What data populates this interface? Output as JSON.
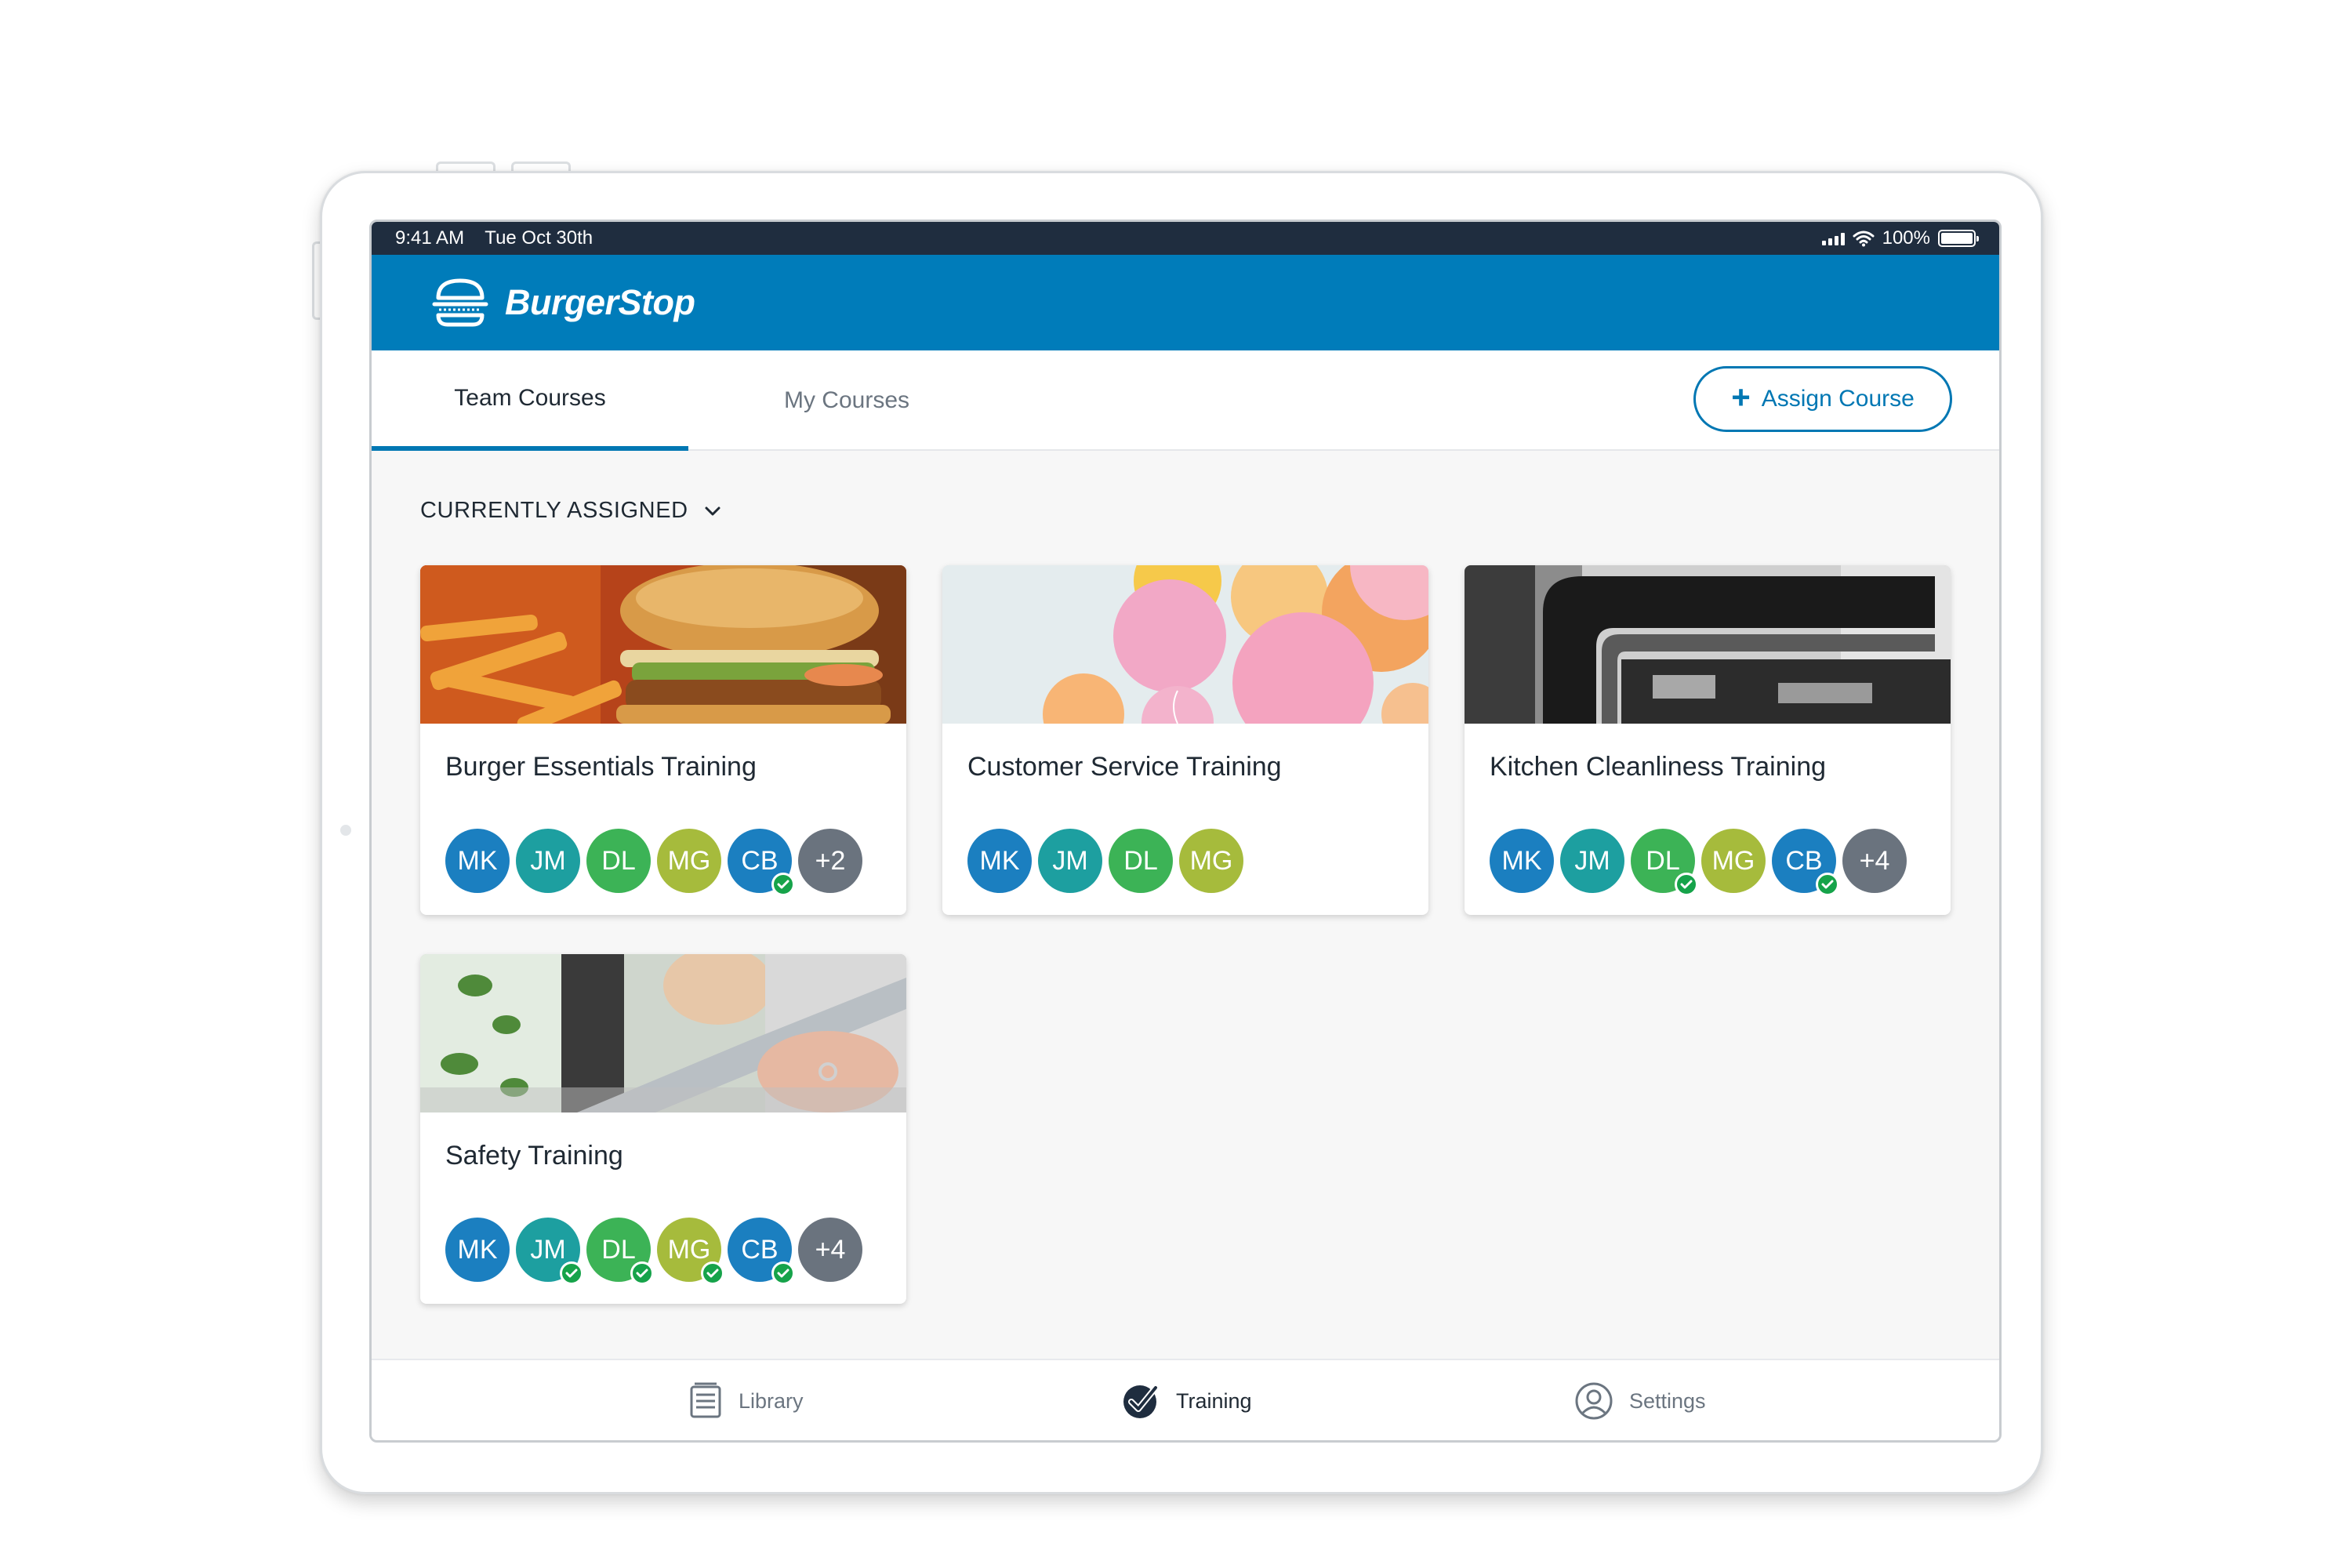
{
  "status_bar": {
    "time": "9:41 AM",
    "date": "Tue Oct 30th",
    "battery": "100%"
  },
  "header": {
    "brand": "BurgerStop",
    "color": "#007cba"
  },
  "tabs": [
    {
      "label": "Team Courses",
      "active": true
    },
    {
      "label": "My Courses",
      "active": false
    }
  ],
  "actions": {
    "assign_course_label": "Assign Course",
    "accent_color": "#0077b3"
  },
  "section": {
    "label": "CURRENTLY ASSIGNED"
  },
  "courses": [
    {
      "title": "Burger Essentials Training",
      "image": "burger-and-fries-photo",
      "avatars": [
        {
          "initials": "MK",
          "completed": false
        },
        {
          "initials": "JM",
          "completed": false
        },
        {
          "initials": "DL",
          "completed": false
        },
        {
          "initials": "MG",
          "completed": false
        },
        {
          "initials": "CB",
          "completed": true
        },
        {
          "initials": "+2",
          "completed": false
        }
      ]
    },
    {
      "title": "Customer Service Training",
      "image": "balloons-photo",
      "avatars": [
        {
          "initials": "MK",
          "completed": false
        },
        {
          "initials": "JM",
          "completed": false
        },
        {
          "initials": "DL",
          "completed": false
        },
        {
          "initials": "MG",
          "completed": false
        }
      ]
    },
    {
      "title": "Kitchen Cleanliness Training",
      "image": "kitchen-faucet-photo",
      "avatars": [
        {
          "initials": "MK",
          "completed": false
        },
        {
          "initials": "JM",
          "completed": false
        },
        {
          "initials": "DL",
          "completed": true
        },
        {
          "initials": "MG",
          "completed": false
        },
        {
          "initials": "CB",
          "completed": true
        },
        {
          "initials": "+4",
          "completed": false
        }
      ]
    },
    {
      "title": "Safety Training",
      "image": "knife-cutting-photo",
      "avatars": [
        {
          "initials": "MK",
          "completed": false
        },
        {
          "initials": "JM",
          "completed": true
        },
        {
          "initials": "DL",
          "completed": true
        },
        {
          "initials": "MG",
          "completed": true
        },
        {
          "initials": "CB",
          "completed": true
        },
        {
          "initials": "+4",
          "completed": false
        }
      ]
    }
  ],
  "bottom_nav": [
    {
      "label": "Library",
      "icon": "library-icon",
      "active": false
    },
    {
      "label": "Training",
      "icon": "checkmark-circle-icon",
      "active": true
    },
    {
      "label": "Settings",
      "icon": "user-circle-icon",
      "active": false
    }
  ]
}
